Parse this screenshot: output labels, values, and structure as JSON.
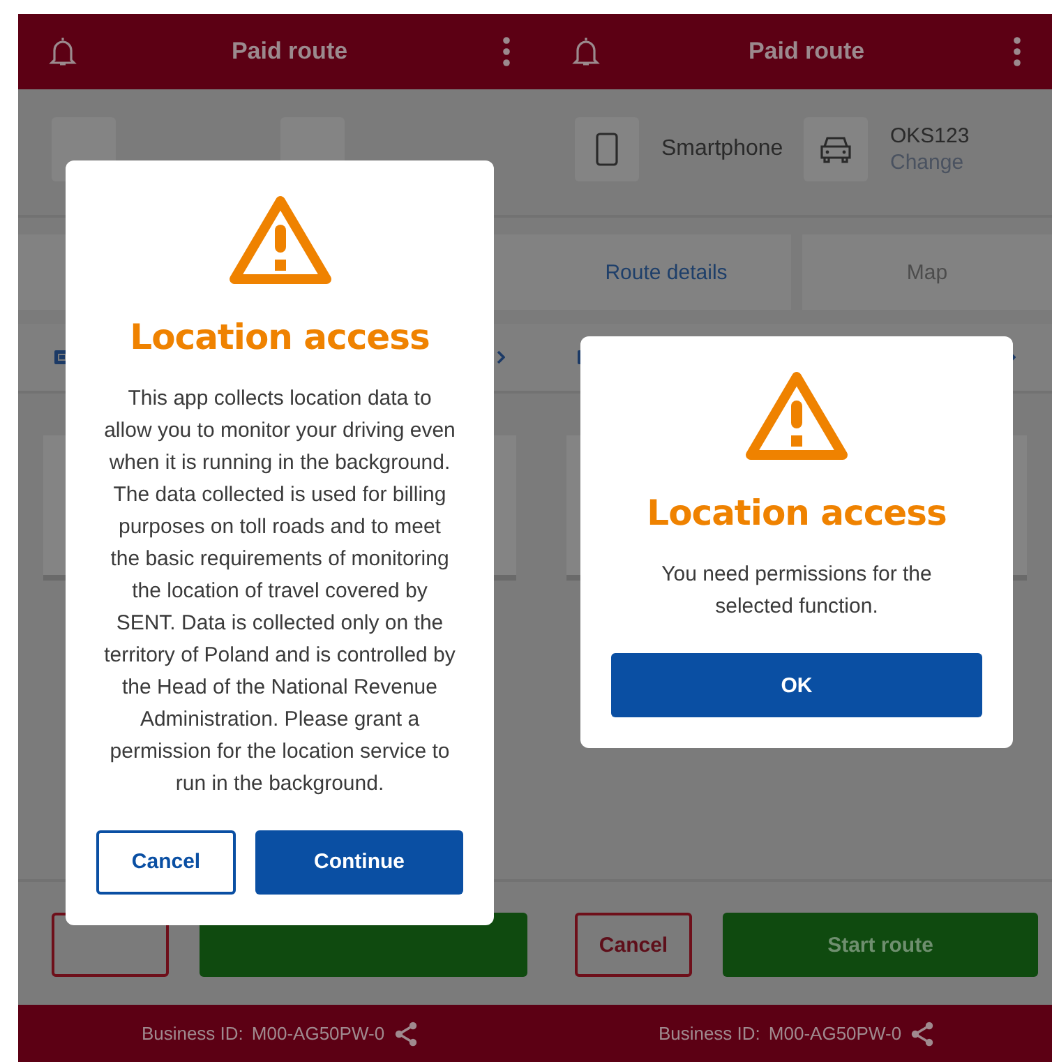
{
  "screens": [
    {
      "header": {
        "title": "Paid route"
      },
      "actions": [
        {
          "kind": "cancel"
        },
        {
          "kind": "start"
        }
      ],
      "footer": {
        "label": "Business ID:",
        "value": "M00-AG50PW-0"
      },
      "dialog": {
        "title": "Location access",
        "message": "This app collects location data to allow you to monitor your driving even when it is running in the background. The data collected is used for billing purposes on toll roads and to meet the basic requirements of monitoring the location of travel covered by SENT. Data is collected only on the territory of Poland and is controlled by the Head of the National Revenue Administration. Please grant a permission for the location service to run in the background.",
        "buttons": [
          {
            "label": "Cancel",
            "kind": "secondary"
          },
          {
            "label": "Continue",
            "kind": "primary"
          }
        ]
      }
    },
    {
      "header": {
        "title": "Paid route"
      },
      "device": {
        "label": "Smartphone"
      },
      "vehicle": {
        "plate": "OKS123",
        "action": "Change"
      },
      "tabs": [
        {
          "label": "Route details",
          "selected": true
        },
        {
          "label": "Map",
          "selected": false
        }
      ],
      "actions": [
        {
          "kind": "cancel",
          "label": "Cancel"
        },
        {
          "kind": "start",
          "label": "Start route"
        }
      ],
      "footer": {
        "label": "Business ID:",
        "value": "M00-AG50PW-0"
      },
      "dialog": {
        "title": "Location access",
        "message": "You need permissions for the selected function.",
        "buttons": [
          {
            "label": "OK",
            "kind": "primary"
          }
        ]
      }
    }
  ]
}
